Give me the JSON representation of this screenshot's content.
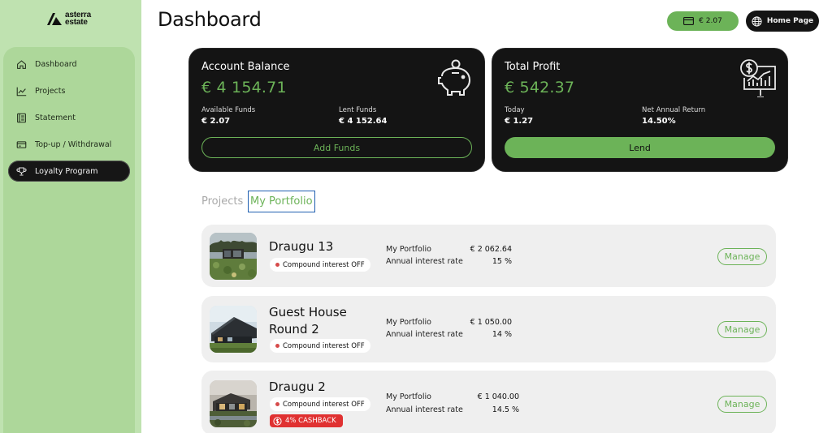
{
  "brand": {
    "line1": "asterra",
    "line2": "estate"
  },
  "sidebar": {
    "items": [
      {
        "label": "Dashboard",
        "icon": "home-icon"
      },
      {
        "label": "Projects",
        "icon": "chart-line-icon"
      },
      {
        "label": "Statement",
        "icon": "statement-icon"
      },
      {
        "label": "Top-up / Withdrawal",
        "icon": "wallet-icon"
      },
      {
        "label": "Loyalty Program",
        "icon": "trophy-icon",
        "active": true
      }
    ]
  },
  "header": {
    "title": "Dashboard",
    "balance": "€ 2.07",
    "home_label": "Home Page"
  },
  "account_card": {
    "title": "Account Balance",
    "amount": "€ 4 154.71",
    "available_label": "Available Funds",
    "available_value": "€ 2.07",
    "lent_label": "Lent Funds",
    "lent_value": "€ 4 152.64",
    "button": "Add Funds"
  },
  "profit_card": {
    "title": "Total Profit",
    "amount": "€ 542.37",
    "today_label": "Today",
    "today_value": "€ 1.27",
    "return_label": "Net Annual Return",
    "return_value": "14.50%",
    "button": "Lend"
  },
  "tabs": {
    "projects": "Projects",
    "portfolio": "My Portfolio"
  },
  "projects": [
    {
      "name_line1": "Draugu 13",
      "name_line2": "",
      "chip": "Compound interest OFF",
      "portfolio_label": "My Portfolio",
      "portfolio_value": "€ 2 062.64",
      "rate_label": "Annual interest rate",
      "rate_value": "15 %",
      "manage": "Manage"
    },
    {
      "name_line1": "Guest House",
      "name_line2": "Round 2",
      "chip": "Compound interest OFF",
      "portfolio_label": "My Portfolio",
      "portfolio_value": "€ 1 050.00",
      "rate_label": "Annual interest rate",
      "rate_value": "14 %",
      "manage": "Manage"
    },
    {
      "name_line1": "Draugu 2",
      "name_line2": "",
      "chip": "Compound interest OFF",
      "cashback": "4% CASHBACK",
      "portfolio_label": "My Portfolio",
      "portfolio_value": "€ 1 040.00",
      "rate_label": "Annual interest rate",
      "rate_value": "14.5 %",
      "manage": "Manage"
    }
  ],
  "colors": {
    "accent": "#6cb358",
    "sidebar": "#bfe2b0",
    "card": "#141414",
    "row": "#efefef",
    "cashback": "#e03131"
  }
}
